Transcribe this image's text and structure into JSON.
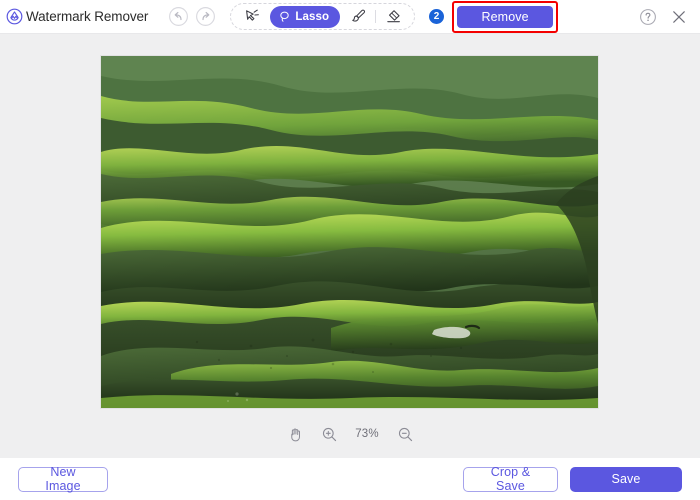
{
  "app": {
    "title": "Watermark Remover",
    "logo_icon": "waterdrop-logo-icon",
    "accent_color": "#5B57E0",
    "highlight_color": "#f40000",
    "badge_color": "#1a63d8",
    "canvas_bg": "#efeff0"
  },
  "header": {
    "history": [
      {
        "name": "undo-button",
        "icon": "undo-arrow-icon",
        "label": "Undo",
        "enabled": false
      },
      {
        "name": "redo-button",
        "icon": "redo-arrow-icon",
        "label": "Redo",
        "enabled": false
      }
    ],
    "tools": [
      {
        "name": "magic-wand-tool",
        "icon": "magic-wand-icon",
        "label": "Magic Wand",
        "active": false
      },
      {
        "name": "lasso-tool",
        "icon": "lasso-icon",
        "label": "Lasso",
        "active": true
      },
      {
        "name": "brush-tool",
        "icon": "brush-icon",
        "label": "Brush",
        "active": false
      },
      {
        "name": "eraser-tool",
        "icon": "eraser-icon",
        "label": "Eraser",
        "active": false
      }
    ],
    "step_badge": "2",
    "remove_label": "Remove",
    "help_icon": "help-circle-icon",
    "close_icon": "close-x-icon"
  },
  "canvas": {
    "image_alt": "Aerial photo of green rolling grassy hills with sunlight and shadow",
    "zoom_controls": {
      "hand_icon": "hand-pan-icon",
      "zoom_in_icon": "zoom-in-icon",
      "zoom_out_icon": "zoom-out-icon",
      "zoom_level": "73%"
    }
  },
  "footer": {
    "new_image_label": "New Image",
    "crop_save_label": "Crop & Save",
    "save_label": "Save"
  }
}
